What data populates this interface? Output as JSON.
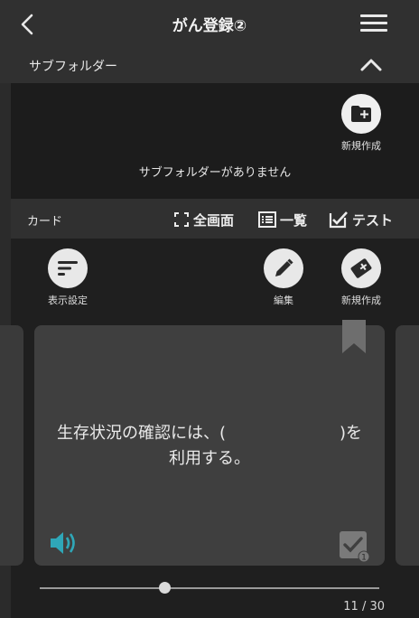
{
  "header": {
    "title": "がん登録②",
    "back_icon": "chevron-left-icon",
    "menu_icon": "hamburger-menu-icon"
  },
  "subfolder": {
    "label": "サブフォルダー",
    "collapse_icon": "chevron-up-icon",
    "new_label": "新規作成",
    "empty_message": "サブフォルダーがありません"
  },
  "card_bar": {
    "label": "カード",
    "fullscreen_label": "全画面",
    "list_label": "一覧",
    "test_label": "テスト"
  },
  "actions": {
    "display_settings_label": "表示設定",
    "edit_label": "編集",
    "new_label": "新規作成"
  },
  "card": {
    "text": "生存状況の確認には、(　　　　　　　)を\n利用する。",
    "check_badge": "1"
  },
  "progress": {
    "current": 11,
    "total": 30,
    "text": "11 / 30",
    "fraction": 0.367
  },
  "colors": {
    "background": "#2b2b2b",
    "card": "#3f3f3f",
    "accent": "#2fa7b8"
  }
}
